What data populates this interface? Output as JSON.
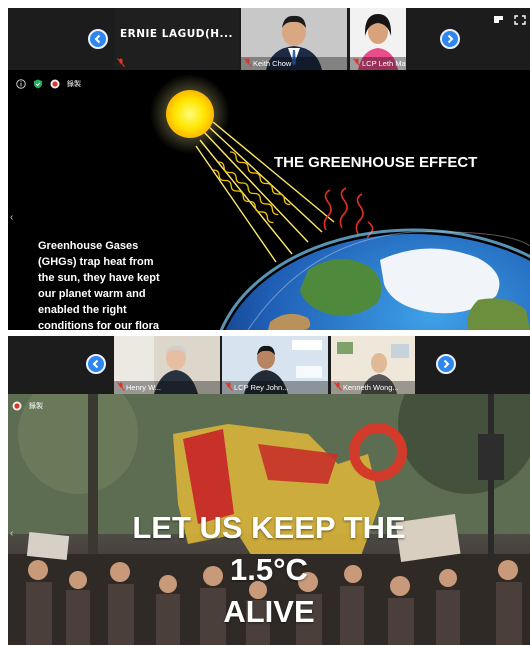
{
  "panel_top": {
    "participants": [
      {
        "name": "ERNIE  LAGUD(H...",
        "muted": true,
        "video": false
      },
      {
        "name": "Keith Chow",
        "muted": true,
        "video": true
      },
      {
        "name": "LCP Leth Mat...",
        "muted": true,
        "video": true
      }
    ],
    "status_label": "錄製",
    "slide": {
      "title": "THE GREENHOUSE EFFECT",
      "body": "Greenhouse Gases (GHGs) trap heat from the sun, they have kept our planet warm and enabled the right conditions for our flora"
    }
  },
  "panel_bottom": {
    "participants": [
      {
        "name": "Henry W...",
        "muted": true,
        "video": true
      },
      {
        "name": "LCP Rey John...",
        "muted": true,
        "video": true
      },
      {
        "name": "Kenneth Wong...",
        "muted": true,
        "video": true
      }
    ],
    "status_label": "錄製",
    "slide": {
      "headline_1": "LET US KEEP THE",
      "headline_2": "1.5°C",
      "headline_3": "ALIVE",
      "background_text": "1.5°"
    }
  },
  "colors": {
    "nav_button": "#2f86ee",
    "mic_off": "#e0332a",
    "sun": "#ffe600"
  },
  "icons": [
    "chevron-left-icon",
    "chevron-right-icon",
    "mic-off-icon",
    "info-icon",
    "shield-icon",
    "record-icon",
    "view-layout-icon",
    "fullscreen-icon"
  ]
}
